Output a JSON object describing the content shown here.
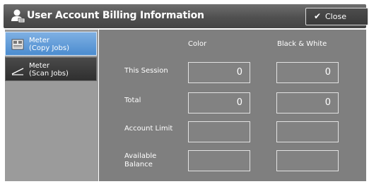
{
  "header": {
    "title": "User Account Billing Information",
    "close_label": "Close",
    "user_icon": "user-account-icon",
    "check_icon": "checkmark-icon"
  },
  "sidebar": {
    "items": [
      {
        "line1": "Meter",
        "line2": "(Copy Jobs)",
        "selected": true,
        "icon": "copy-jobs-icon"
      },
      {
        "line1": "Meter",
        "line2": "(Scan Jobs)",
        "selected": false,
        "icon": "scan-jobs-icon"
      }
    ]
  },
  "table": {
    "columns": [
      "Color",
      "Black & White"
    ],
    "rows": [
      {
        "label_line1": "This Session",
        "label_line2": "",
        "color": "0",
        "bw": "0"
      },
      {
        "label_line1": "Total",
        "label_line2": "",
        "color": "0",
        "bw": "0"
      },
      {
        "label_line1": "Account Limit",
        "label_line2": "",
        "color": "",
        "bw": ""
      },
      {
        "label_line1": "Available",
        "label_line2": "Balance",
        "color": "",
        "bw": ""
      }
    ]
  },
  "colors": {
    "selected_tab": "#5b9bd8",
    "panel_bg": "#7f7f7f",
    "sidebar_bg": "#9b9b9b",
    "title_bg": "#555555"
  }
}
